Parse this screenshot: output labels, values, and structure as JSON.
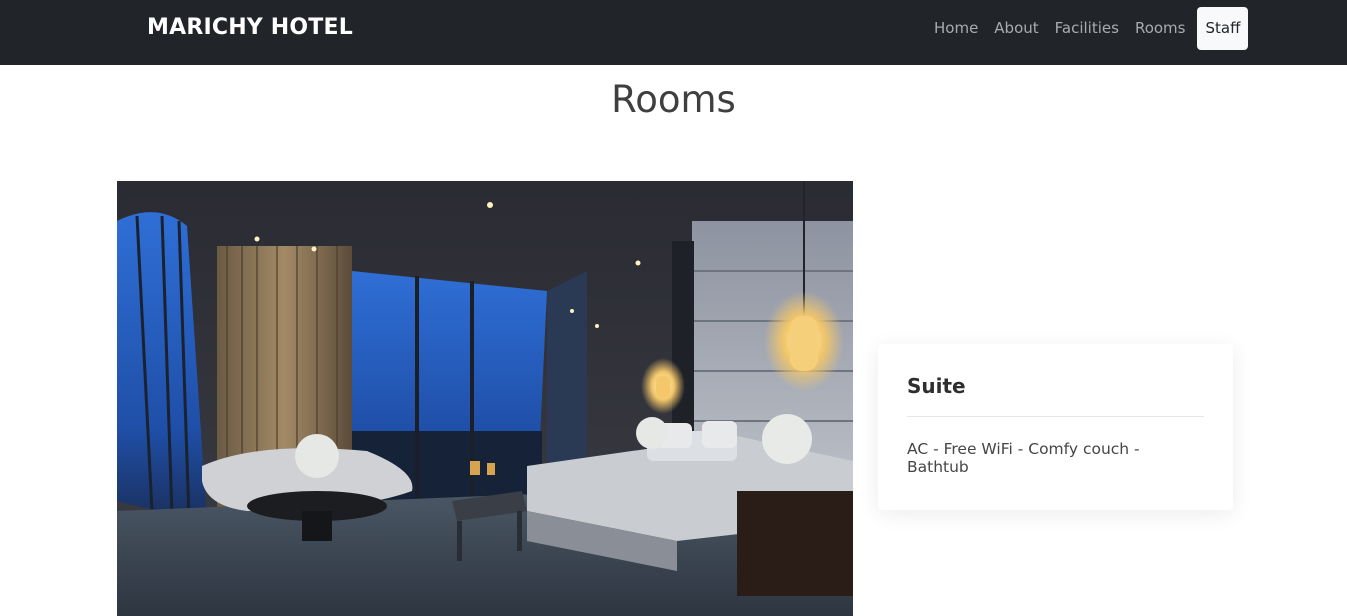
{
  "navbar": {
    "brand": "MARICHY HOTEL",
    "links": [
      {
        "label": "Home"
      },
      {
        "label": "About"
      },
      {
        "label": "Facilities"
      },
      {
        "label": "Rooms"
      },
      {
        "label": "Staff"
      }
    ]
  },
  "main": {
    "title": "Rooms"
  },
  "room": {
    "name": "Suite",
    "amenities": "AC - Free WiFi - Comfy couch - Bathtub"
  },
  "colors": {
    "navbar_bg": "#212529",
    "active_link_bg": "#f8f9fa"
  }
}
